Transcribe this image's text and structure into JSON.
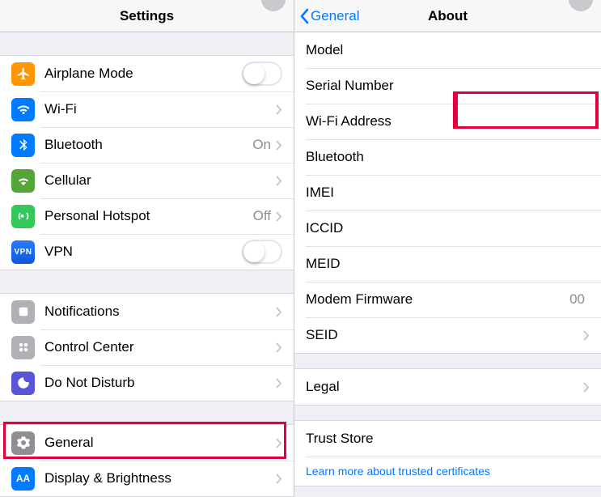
{
  "left": {
    "title": "Settings",
    "group1": {
      "airplane": "Airplane Mode",
      "wifi": {
        "label": "Wi-Fi",
        "value": " "
      },
      "bluetooth": {
        "label": "Bluetooth",
        "value": "On"
      },
      "cellular": "Cellular",
      "hotspot": {
        "label": "Personal Hotspot",
        "value": "Off"
      },
      "vpn": "VPN"
    },
    "group2": {
      "notifications": "Notifications",
      "controlcenter": "Control Center",
      "dnd": "Do Not Disturb"
    },
    "group3": {
      "general": "General",
      "display": "Display & Brightness"
    }
  },
  "right": {
    "back": "General",
    "title": "About",
    "rows": {
      "model": {
        "label": "Model",
        "value": " "
      },
      "serial": {
        "label": "Serial Number",
        "value": " "
      },
      "wifiaddr": {
        "label": "Wi-Fi Address",
        "value": " "
      },
      "bt": {
        "label": "Bluetooth",
        "value": " "
      },
      "imei": {
        "label": "IMEI",
        "value": " "
      },
      "iccid": {
        "label": "ICCID",
        "value": " "
      },
      "meid": {
        "label": "MEID",
        "value": " "
      },
      "modem": {
        "label": "Modem Firmware",
        "value": "00"
      },
      "seid": {
        "label": "SEID"
      },
      "legal": {
        "label": "Legal"
      },
      "trust": {
        "label": "Trust Store",
        "value": " "
      },
      "learn": "Learn more about trusted certificates"
    }
  }
}
